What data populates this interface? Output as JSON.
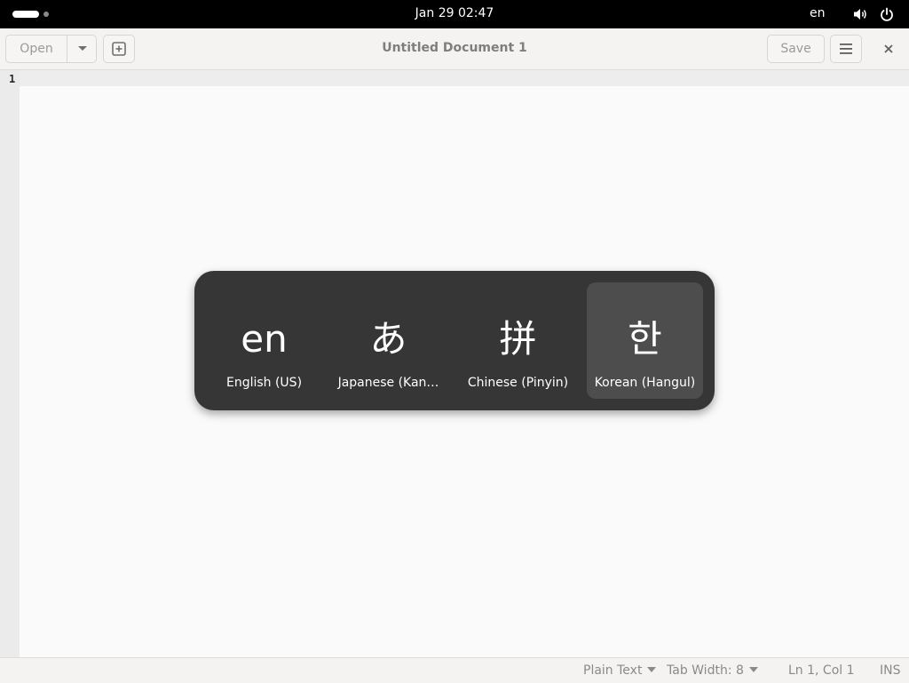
{
  "topbar": {
    "clock": "Jan 29  02:47",
    "input_indicator": "en",
    "icons": [
      "activities-indicator",
      "volume-icon",
      "power-icon"
    ]
  },
  "headerbar": {
    "open_label": "Open",
    "save_label": "Save",
    "title": "Untitled Document 1",
    "icons": [
      "chevron-down-icon",
      "new-tab-icon",
      "hamburger-menu-icon",
      "close-icon"
    ]
  },
  "editor": {
    "line_numbers": [
      "1"
    ]
  },
  "statusbar": {
    "language": "Plain Text",
    "tab_width": "Tab Width: 8",
    "cursor_position": "Ln 1, Col 1",
    "mode": "INS"
  },
  "input_switcher": {
    "sources": [
      {
        "symbol": "en",
        "name": "English (US)",
        "selected": false
      },
      {
        "symbol": "あ",
        "name": "Japanese (Kan…",
        "selected": false
      },
      {
        "symbol": "拼",
        "name": "Chinese (Pinyin)",
        "selected": false
      },
      {
        "symbol": "한",
        "name": "Korean (Hangul)",
        "selected": true
      }
    ]
  },
  "colors": {
    "topbar_bg": "#000000",
    "switcher_bg": "#363636",
    "switcher_selected": "#4d4d4d"
  }
}
